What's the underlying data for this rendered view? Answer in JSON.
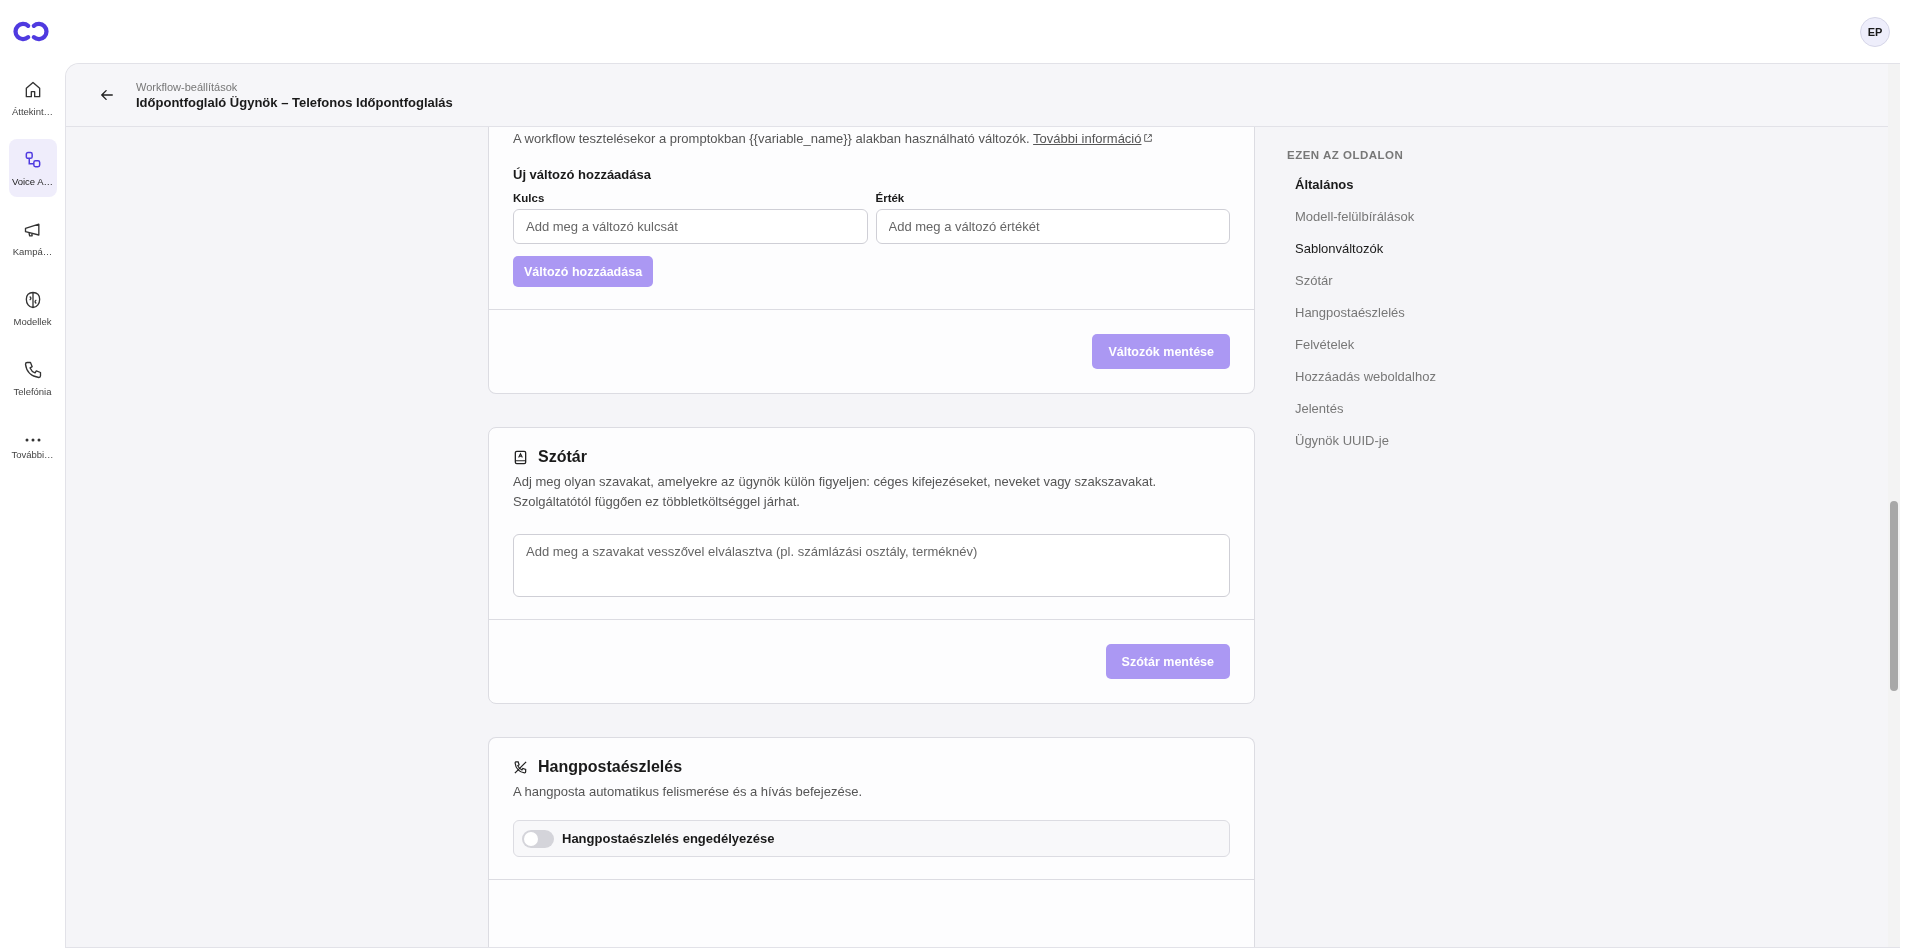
{
  "app": {
    "avatar": "EP"
  },
  "rail": [
    {
      "label": "Áttekint…",
      "selected": false
    },
    {
      "label": "Voice A…",
      "selected": true
    },
    {
      "label": "Kampá…",
      "selected": false
    },
    {
      "label": "Modellek",
      "selected": false
    },
    {
      "label": "Telefónia",
      "selected": false
    },
    {
      "label": "További…",
      "selected": false
    }
  ],
  "header": {
    "breadcrumb": "Workflow-beállítások",
    "title": "Időpontfoglaló Ügynök – Telefonos Időpontfoglalás"
  },
  "variables_card": {
    "description": "A workflow tesztelésekor a promptokban {{variable_name}} alakban használható változók.",
    "link": "További információ",
    "subtitle": "Új változó hozzáadása",
    "fields": [
      {
        "label": "Kulcs",
        "placeholder": "Add meg a változó kulcsát"
      },
      {
        "label": "Érték",
        "placeholder": "Add meg a változó értékét"
      }
    ],
    "add_button": {
      "label": "Változó hozzáadása",
      "disabled": true
    },
    "save_button": {
      "label": "Változók mentése",
      "disabled": true
    }
  },
  "dictionary_card": {
    "title": "Szótár",
    "description": "Adj meg olyan szavakat, amelyekre az ügynök külön figyeljen: céges kifejezéseket, neveket vagy szakszavakat. Szolgáltatótól függően ez többletköltséggel járhat.",
    "placeholder": "Add meg a szavakat vesszővel elválasztva (pl. számlázási osztály, terméknév)",
    "save_button": {
      "label": "Szótár mentése",
      "disabled": true
    }
  },
  "voicemail_card": {
    "title": "Hangpostaészlelés",
    "description": "A hangposta automatikus felismerése és a hívás befejezése.",
    "toggle": {
      "label": "Hangpostaészlelés engedélyezése",
      "on": false
    }
  },
  "toc": {
    "heading": "EZEN AZ OLDALON",
    "items": [
      {
        "label": "Általános",
        "selected": true,
        "in_view": false
      },
      {
        "label": "Modell-felülbírálások",
        "selected": false,
        "in_view": false
      },
      {
        "label": "Sablonváltozók",
        "selected": false,
        "in_view": true
      },
      {
        "label": "Szótár",
        "selected": false,
        "in_view": false
      },
      {
        "label": "Hangpostaészlelés",
        "selected": false,
        "in_view": false
      },
      {
        "label": "Felvételek",
        "selected": false,
        "in_view": false
      },
      {
        "label": "Hozzáadás weboldalhoz",
        "selected": false,
        "in_view": false
      },
      {
        "label": "Jelentés",
        "selected": false,
        "in_view": false
      },
      {
        "label": "Ügynök UUID-je",
        "selected": false,
        "in_view": false
      }
    ]
  }
}
